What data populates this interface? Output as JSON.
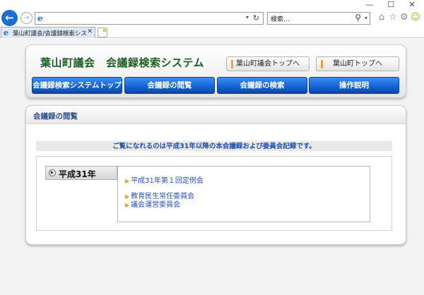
{
  "browser": {
    "window_controls": {
      "minimize": "—",
      "maximize": "☐",
      "close": "✕"
    },
    "address_dropdown": "▾",
    "search_placeholder": "検索...",
    "tab": {
      "title": "葉山町議会/会議録検索シス...",
      "close": "✕"
    }
  },
  "header": {
    "site_title": "葉山町議会　会議録検索システム",
    "links": [
      "葉山町議会トップへ",
      "葉山町トップへ"
    ],
    "nav": [
      "会議録検索システムトップ",
      "会議録の閲覧",
      "会議録の検索",
      "操作説明"
    ]
  },
  "content": {
    "section_title": "会議録の閲覧",
    "notice": "ご覧になれるのは平成31年以降の本会議録および委員会記録です。",
    "year_label": "平成31年",
    "meetings": [
      "平成31年第１回定例会",
      "教育民生常任委員会",
      "議会運営委員会"
    ]
  },
  "colors": {
    "nav_button": "#1565d8",
    "site_title": "#1b5e20",
    "notice_text": "#1d4fb0",
    "link_text": "#2952b8",
    "arrow": "#e8a020"
  },
  "icons": {
    "back": "back-arrow-icon",
    "forward": "forward-arrow-icon",
    "ie": "ie-logo-icon",
    "refresh": "refresh-icon",
    "search": "search-icon",
    "home": "home-icon",
    "favorites": "star-icon",
    "settings": "gear-icon",
    "feedback": "smiley-icon"
  }
}
